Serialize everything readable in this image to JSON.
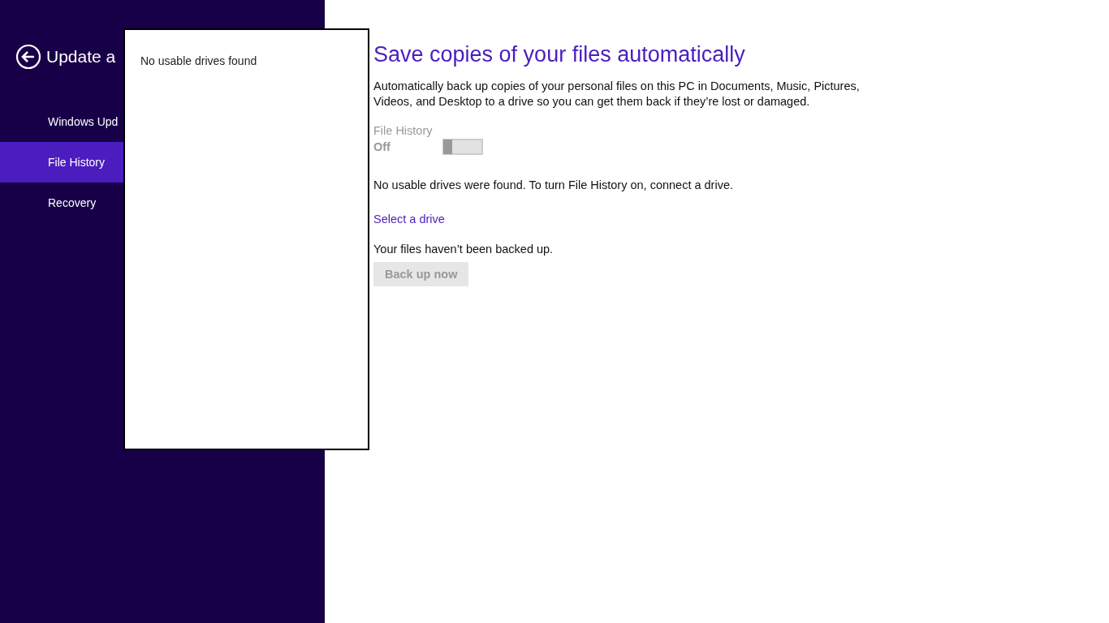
{
  "sidebar": {
    "title": "Update a",
    "items": [
      {
        "label": "Windows Upd",
        "selected": false
      },
      {
        "label": "File History",
        "selected": true
      },
      {
        "label": "Recovery",
        "selected": false
      }
    ]
  },
  "popup": {
    "message": "No usable drives found"
  },
  "main": {
    "heading": "Save copies of your files automatically",
    "description": "Automatically back up copies of your personal files on this PC in Documents, Music, Pictures, Videos, and Desktop to a drive so you can get them back if they’re lost or damaged.",
    "toggle": {
      "label": "File History",
      "state_text": "Off",
      "on": false,
      "disabled": true
    },
    "status": "No usable drives were found. To turn File History on, connect a drive.",
    "link": "Select a drive",
    "backup_status": "Your files haven’t been backed up.",
    "button": {
      "label": "Back up now",
      "disabled": true
    }
  }
}
